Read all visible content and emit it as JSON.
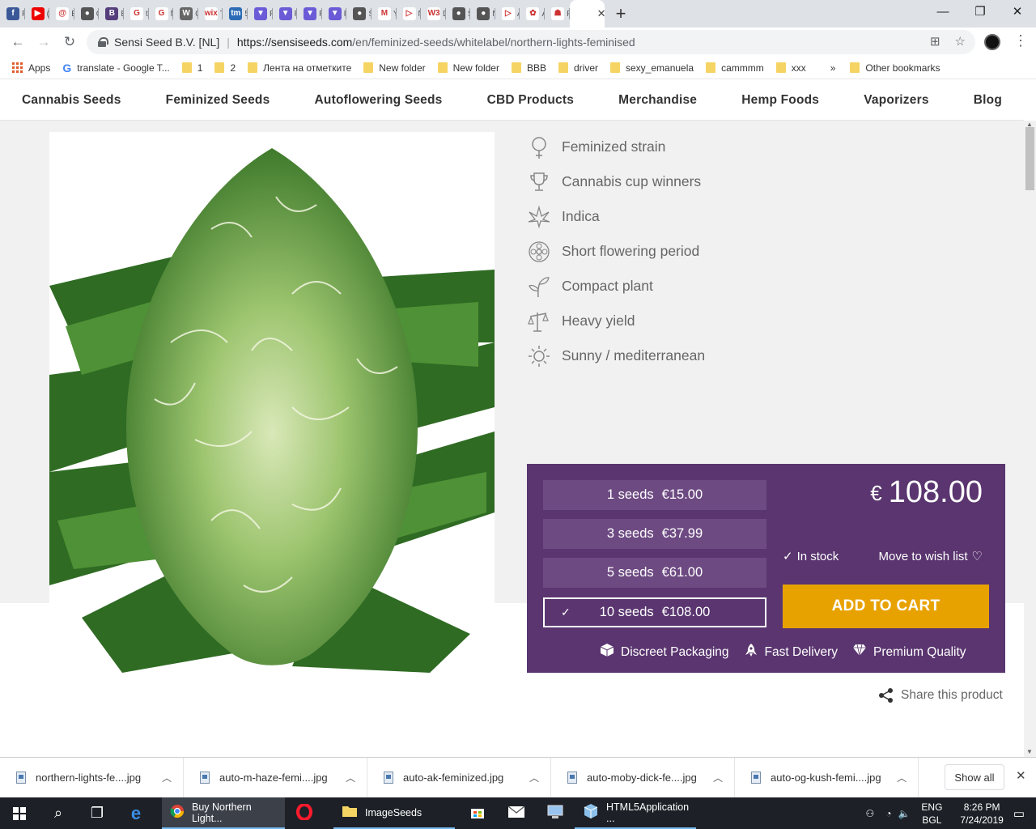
{
  "browser": {
    "tabs": [
      {
        "icon": "facebook-icon",
        "short": "F",
        "color": "#3b5998",
        "letter": "f"
      },
      {
        "icon": "youtube-icon",
        "short": "(",
        "color": "#e00",
        "letter": "▶"
      },
      {
        "icon": "spiral-icon",
        "short": "E",
        "color": "#fff",
        "letter": "@"
      },
      {
        "icon": "circle-icon",
        "short": "C",
        "color": "#555",
        "letter": "●"
      },
      {
        "icon": "bootstrap-icon",
        "short": "E",
        "color": "#563d7c",
        "letter": "B"
      },
      {
        "icon": "google-icon",
        "short": "t",
        "color": "#fff",
        "letter": "G"
      },
      {
        "icon": "google-icon",
        "short": "f",
        "color": "#fff",
        "letter": "G"
      },
      {
        "icon": "wordpress-icon",
        "short": "C",
        "color": "#666",
        "letter": "W"
      },
      {
        "icon": "wix-icon",
        "short": "T",
        "color": "#fff",
        "letter": "wix"
      },
      {
        "icon": "tm-icon",
        "short": "5",
        "color": "#2d6cb5",
        "letter": "tm"
      },
      {
        "icon": "shield-icon",
        "short": "F",
        "color": "#6b5bd6",
        "letter": "▼"
      },
      {
        "icon": "shield-icon",
        "short": "F",
        "color": "#6b5bd6",
        "letter": "▼"
      },
      {
        "icon": "shield-icon",
        "short": "F",
        "color": "#6b5bd6",
        "letter": "▼"
      },
      {
        "icon": "shield-icon",
        "short": "F",
        "color": "#6b5bd6",
        "letter": "▼"
      },
      {
        "icon": "circle-icon",
        "short": "S",
        "color": "#555",
        "letter": "●"
      },
      {
        "icon": "gmail-icon",
        "short": "Y",
        "color": "#fff",
        "letter": "M"
      },
      {
        "icon": "play-icon",
        "short": "N",
        "color": "#fff",
        "letter": "▷"
      },
      {
        "icon": "w3schools-icon",
        "short": "D",
        "color": "#fff",
        "letter": "W3"
      },
      {
        "icon": "circle-icon",
        "short": "S",
        "color": "#555",
        "letter": "●"
      },
      {
        "icon": "circle-icon",
        "short": "N",
        "color": "#555",
        "letter": "●"
      },
      {
        "icon": "play-icon",
        "short": "A",
        "color": "#fff",
        "letter": "▷"
      },
      {
        "icon": "leaf-icon",
        "short": "A",
        "color": "#fff",
        "letter": "✿"
      },
      {
        "icon": "witch-icon",
        "short": "F",
        "color": "#fff",
        "letter": "☗"
      },
      {
        "icon": "page-icon",
        "short": "B",
        "color": "#fff",
        "letter": ""
      }
    ],
    "active_tab_close": "✕",
    "new_tab": "+",
    "window_controls": [
      "—",
      "❐",
      "✕"
    ],
    "site_identity": "Sensi Seed B.V. [NL]",
    "url_host": "https://sensiseeds.com",
    "url_path": "/en/feminized-seeds/whitelabel/northern-lights-feminised",
    "bookmarks": [
      {
        "label": "Apps",
        "type": "apps"
      },
      {
        "label": "translate - Google T...",
        "type": "google"
      },
      {
        "label": "1",
        "type": "folder"
      },
      {
        "label": "2",
        "type": "folder"
      },
      {
        "label": "Лента на отметките",
        "type": "folder"
      },
      {
        "label": "New folder",
        "type": "folder"
      },
      {
        "label": "New folder",
        "type": "folder"
      },
      {
        "label": "BBB",
        "type": "folder"
      },
      {
        "label": "driver",
        "type": "folder"
      },
      {
        "label": "sexy_emanuela",
        "type": "folder"
      },
      {
        "label": "cammmm",
        "type": "folder"
      },
      {
        "label": "xxx",
        "type": "folder"
      }
    ],
    "bookmarks_more": "»",
    "other_bookmarks": "Other bookmarks"
  },
  "site_nav": [
    "Cannabis Seeds",
    "Feminized Seeds",
    "Autoflowering Seeds",
    "CBD Products",
    "Merchandise",
    "Hemp Foods",
    "Vaporizers",
    "Blog"
  ],
  "features": [
    {
      "label": "Feminized strain",
      "icon": "female-symbol-icon"
    },
    {
      "label": "Cannabis cup winners",
      "icon": "trophy-icon"
    },
    {
      "label": "Indica",
      "icon": "cannabis-leaf-icon"
    },
    {
      "label": "Short flowering period",
      "icon": "flower-icon"
    },
    {
      "label": "Compact plant",
      "icon": "sprout-icon"
    },
    {
      "label": "Heavy yield",
      "icon": "scale-icon"
    },
    {
      "label": "Sunny / mediterranean",
      "icon": "sun-icon"
    }
  ],
  "seed_options": [
    {
      "label": "1 seeds",
      "price": "€15.00",
      "selected": false
    },
    {
      "label": "3 seeds",
      "price": "€37.99",
      "selected": false
    },
    {
      "label": "5 seeds",
      "price": "€61.00",
      "selected": false
    },
    {
      "label": "10 seeds",
      "price": "€108.00",
      "selected": true
    }
  ],
  "price": {
    "currency": "€",
    "amount": "108.00"
  },
  "stock": "In stock",
  "wishlist": "Move to wish list",
  "add_to_cart": "ADD TO CART",
  "usps": [
    {
      "label": "Discreet Packaging",
      "icon": "box-icon"
    },
    {
      "label": "Fast Delivery",
      "icon": "rocket-icon"
    },
    {
      "label": "Premium Quality",
      "icon": "diamond-icon"
    }
  ],
  "share": "Share this product",
  "downloads": [
    "northern-lights-fe....jpg",
    "auto-m-haze-femi....jpg",
    "auto-ak-feminized.jpg",
    "auto-moby-dick-fe....jpg",
    "auto-og-kush-femi....jpg"
  ],
  "show_all": "Show all",
  "taskbar": {
    "apps": [
      {
        "label": "Buy Northern Light...",
        "icon": "chrome-icon",
        "state": "active"
      },
      {
        "label": "",
        "icon": "opera-icon",
        "state": "none"
      },
      {
        "label": "ImageSeeds",
        "icon": "folder-icon",
        "state": "open"
      },
      {
        "label": "",
        "icon": "store-icon",
        "state": "none"
      },
      {
        "label": "",
        "icon": "mail-icon",
        "state": "none"
      },
      {
        "label": "",
        "icon": "computer-icon",
        "state": "none"
      },
      {
        "label": "HTML5Application ...",
        "icon": "cube-icon",
        "state": "open"
      }
    ],
    "lang_top": "ENG",
    "lang_bottom": "BGL",
    "time": "8:26 PM",
    "date": "7/24/2019"
  },
  "colors": {
    "buy_box": "#5a356f",
    "seed_option": "#6d4a82",
    "cart_button": "#e8a200"
  }
}
